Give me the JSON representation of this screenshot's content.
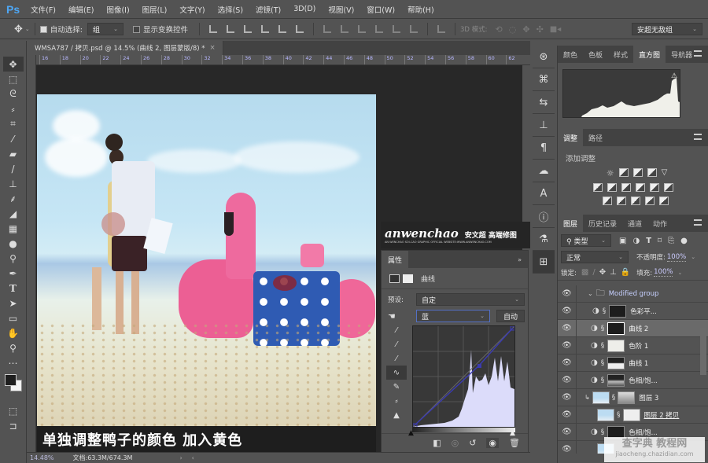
{
  "app": {
    "logo": "Ps",
    "accent": "#4ea7f5"
  },
  "menu": [
    "文件(F)",
    "编辑(E)",
    "图像(I)",
    "图层(L)",
    "文字(Y)",
    "选择(S)",
    "滤镜(T)",
    "3D(D)",
    "视图(V)",
    "窗口(W)",
    "帮助(H)"
  ],
  "options": {
    "auto_select_label": "自动选择:",
    "auto_select_value": "组",
    "show_transform_label": "显示变换控件",
    "mode_3d_label": "3D 模式:",
    "workspace": "安超无敌组"
  },
  "document": {
    "tab_title": "WMSA787 / 拷贝.psd @ 14.5% (曲线 2, 图层蒙版/8) *",
    "ruler_ticks": [
      "16",
      "18",
      "20",
      "22",
      "24",
      "26",
      "28",
      "30",
      "32",
      "34",
      "36",
      "38",
      "40",
      "42",
      "44",
      "46",
      "48",
      "50",
      "52",
      "54",
      "56",
      "58",
      "60",
      "62"
    ],
    "caption": "单独调整鸭子的颜色 加入黄色",
    "watermark_main": "anwenchao",
    "watermark_cn": "安文超 高端修图",
    "watermark_sub": "AN WENCHAO  SOI-CAO GRAPHIC OFFICIAL  WEBSITE:WWW.ANWENCHAO.COM"
  },
  "status": {
    "zoom": "14.48%",
    "doc": "文档:63.3M/674.3M"
  },
  "properties": {
    "tab": "属性",
    "title": "曲线",
    "preset_label": "预设:",
    "preset_value": "自定",
    "channel_value": "蓝",
    "auto_button": "自动"
  },
  "panels": {
    "top_tabs": [
      "颜色",
      "色板",
      "样式",
      "直方图",
      "导航器"
    ],
    "top_active": 3,
    "adj_tabs": [
      "调整",
      "路径"
    ],
    "adj_title": "添加调整",
    "layers_tabs": [
      "图层",
      "历史记录",
      "通道",
      "动作"
    ],
    "filter_kind": "类型",
    "blend_mode": "正常",
    "opacity_label": "不透明度:",
    "opacity_value": "100%",
    "lock_label": "锁定:",
    "fill_label": "填充:",
    "fill_value": "100%",
    "layers": [
      {
        "name": "Modified group",
        "type": "group"
      },
      {
        "name": "色彩平...",
        "type": "adj"
      },
      {
        "name": "曲线 2",
        "type": "adj",
        "selected": true
      },
      {
        "name": "色阶 1",
        "type": "adj"
      },
      {
        "name": "曲线 1",
        "type": "adj"
      },
      {
        "name": "色相/饱...",
        "type": "adj"
      },
      {
        "name": "图层 3",
        "type": "pixel"
      },
      {
        "name": "图层 2 拷贝",
        "type": "pixel"
      },
      {
        "name": "色相/饱...",
        "type": "adj"
      },
      {
        "name": "",
        "type": "pixel"
      }
    ]
  },
  "site_watermark": {
    "main": "查字典 教程网",
    "sub": "jiaocheng.chazidian.com"
  }
}
